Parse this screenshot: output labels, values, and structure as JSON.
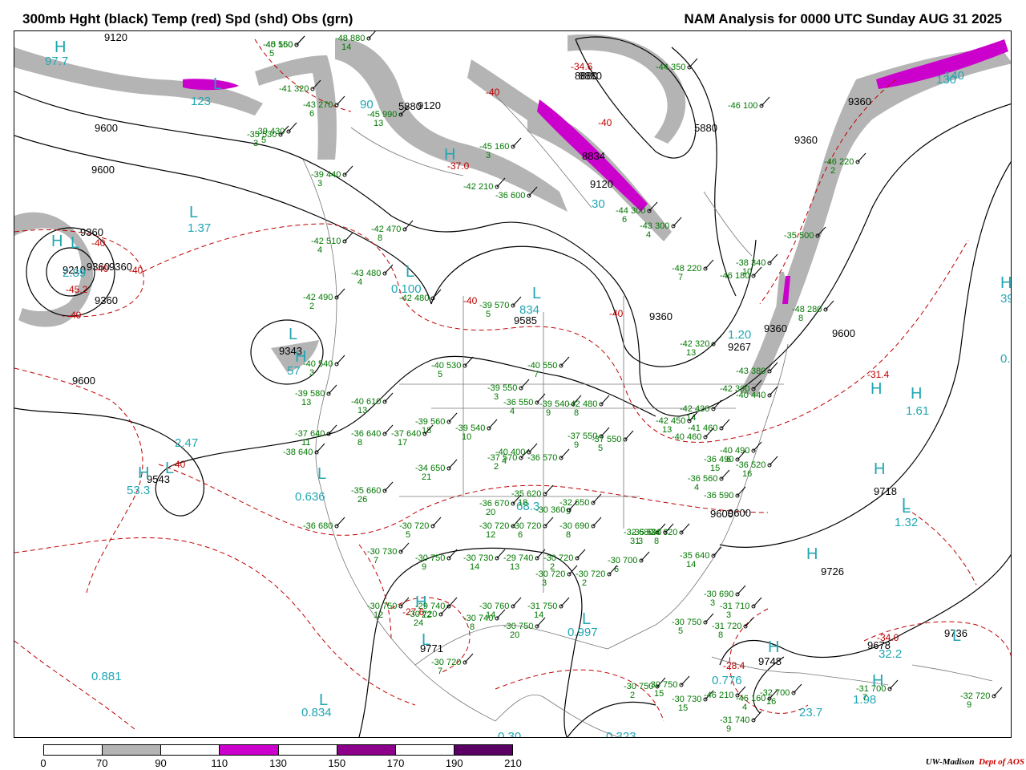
{
  "title_left": "300mb Hght (black) Temp (red) Spd (shd) Obs (grn)",
  "title_right": "NAM Analysis for 0000 UTC Sunday  AUG 31 2025",
  "credit": {
    "org": "UW-Madison",
    "dept": "Dept of AOS"
  },
  "colorbar": {
    "labels": [
      "0",
      "70",
      "90",
      "110",
      "130",
      "150",
      "170",
      "190",
      "210"
    ],
    "colors": [
      "#ffffff",
      "#b4b4b4",
      "#ffffff",
      "#cc00cc",
      "#ffffff",
      "#8c008c",
      "#ffffff",
      "#5a0064"
    ]
  },
  "height_labels": [
    "9120",
    "9600",
    "9600",
    "9360",
    "9360",
    "9360",
    "9210",
    "9360",
    "9343",
    "9600",
    "9543",
    "5880",
    "8880",
    "9120",
    "8834",
    "8880",
    "9120",
    "5880",
    "9360",
    "9360",
    "9600",
    "9585",
    "9360",
    "9267",
    "9360",
    "9600",
    "9718",
    "9726",
    "9678",
    "9736",
    "9748",
    "9771",
    "9600"
  ],
  "temp_labels": [
    "-40",
    "-40",
    "-40",
    "-45.2",
    "-40",
    "-37.0",
    "-34.6",
    "-40",
    "-40",
    "-40",
    "-40",
    "-31.4",
    "-34.0",
    "-28.4",
    "-27.6",
    "-40"
  ],
  "center_letters": [
    "H",
    "L",
    "H",
    "L",
    "L",
    "H",
    "L",
    "L",
    "L",
    "H",
    "H",
    "L",
    "L",
    "H",
    "L",
    "H",
    "H",
    "L",
    "H",
    "H",
    "L",
    "L",
    "H",
    "L",
    "H",
    "L",
    "H"
  ],
  "speed_labels": [
    "97.7",
    "123",
    "90",
    "1.37",
    "2.89",
    "0.100",
    "834",
    "1.20",
    "57",
    "2.47",
    "53.3",
    "0.636",
    "68.3",
    "0.997",
    "0.881",
    "0.834",
    "1.61",
    "1.32",
    "0.776",
    "23.7",
    "1.98",
    "32.2",
    "39.1",
    "0.8",
    "30",
    "130",
    "140",
    "0.323",
    "0.30"
  ],
  "obs": [
    {
      "t": "-45",
      "h": "160",
      "d": "5"
    },
    {
      "t": "-48",
      "h": "880",
      "d": "14"
    },
    {
      "t": "-41",
      "h": "320",
      "d": ""
    },
    {
      "t": "-43",
      "h": "270",
      "d": "6"
    },
    {
      "t": "-39",
      "h": "430",
      "d": "5"
    },
    {
      "t": "-45",
      "h": "990",
      "d": "13"
    },
    {
      "t": "-35",
      "h": "530",
      "d": "3"
    },
    {
      "t": "-45",
      "h": "160",
      "d": "3"
    },
    {
      "t": "-42",
      "h": "210",
      "d": ""
    },
    {
      "t": "-39",
      "h": "440",
      "d": "3"
    },
    {
      "t": "-42",
      "h": "470",
      "d": "8"
    },
    {
      "t": "-42",
      "h": "510",
      "d": "4"
    },
    {
      "t": "-43",
      "h": "480",
      "d": "4"
    },
    {
      "t": "-42",
      "h": "490",
      "d": "2"
    },
    {
      "t": "-42",
      "h": "480",
      "d": ""
    },
    {
      "t": "-40",
      "h": "540",
      "d": "3"
    },
    {
      "t": "-39",
      "h": "580",
      "d": "13"
    },
    {
      "t": "-40",
      "h": "610",
      "d": "13"
    },
    {
      "t": "-40",
      "h": "530",
      "d": "5"
    },
    {
      "t": "-39",
      "h": "570",
      "d": "5"
    },
    {
      "t": "-40",
      "h": "550",
      "d": "7"
    },
    {
      "t": "-39",
      "h": "550",
      "d": "3"
    },
    {
      "t": "-36",
      "h": "550",
      "d": "4"
    },
    {
      "t": "-39",
      "h": "540",
      "d": "9"
    },
    {
      "t": "-42",
      "h": "480",
      "d": "8"
    },
    {
      "t": "-39",
      "h": "560",
      "d": "18"
    },
    {
      "t": "-39",
      "h": "540",
      "d": "10"
    },
    {
      "t": "-37",
      "h": "640",
      "d": "11"
    },
    {
      "t": "-36",
      "h": "640",
      "d": "8"
    },
    {
      "t": "-37",
      "h": "640",
      "d": "17"
    },
    {
      "t": "-38",
      "h": "640",
      "d": ""
    },
    {
      "t": "-34",
      "h": "650",
      "d": "21"
    },
    {
      "t": "-37",
      "h": "570",
      "d": "2"
    },
    {
      "t": "-36",
      "h": "570",
      "d": ""
    },
    {
      "t": "-37",
      "h": "550",
      "d": "9"
    },
    {
      "t": "-37",
      "h": "550",
      "d": "5"
    },
    {
      "t": "-35",
      "h": "660",
      "d": "26"
    },
    {
      "t": "-35",
      "h": "620",
      "d": "18"
    },
    {
      "t": "-36",
      "h": "670",
      "d": "20"
    },
    {
      "t": "-32",
      "h": "650",
      "d": "9"
    },
    {
      "t": "-36",
      "h": "680",
      "d": ""
    },
    {
      "t": "-30",
      "h": "720",
      "d": "5"
    },
    {
      "t": "-30",
      "h": "720",
      "d": "12"
    },
    {
      "t": "-30",
      "h": "720",
      "d": "6"
    },
    {
      "t": "-30",
      "h": "690",
      "d": "8"
    },
    {
      "t": "-32",
      "h": "680",
      "d": "31"
    },
    {
      "t": "-34",
      "h": "620",
      "d": "8"
    },
    {
      "t": "-35",
      "h": "590",
      "d": "3"
    },
    {
      "t": "-30",
      "h": "730",
      "d": "7"
    },
    {
      "t": "-30",
      "h": "750",
      "d": "9"
    },
    {
      "t": "-30",
      "h": "730",
      "d": "14"
    },
    {
      "t": "-29",
      "h": "740",
      "d": "13"
    },
    {
      "t": "-30",
      "h": "720",
      "d": "2"
    },
    {
      "t": "-30",
      "h": "700",
      "d": "6"
    },
    {
      "t": "-30",
      "h": "720",
      "d": "2"
    },
    {
      "t": "-30",
      "h": "720",
      "d": "3"
    },
    {
      "t": "-35",
      "h": "640",
      "d": "14"
    },
    {
      "t": "-30",
      "h": "750",
      "d": "12"
    },
    {
      "t": "-29",
      "h": "740",
      "d": "22"
    },
    {
      "t": "-30",
      "h": "760",
      "d": "14"
    },
    {
      "t": "-31",
      "h": "750",
      "d": "14"
    },
    {
      "t": "-30",
      "h": "690",
      "d": "3"
    },
    {
      "t": "-31",
      "h": "710",
      "d": "3"
    },
    {
      "t": "-31",
      "h": "720",
      "d": "8"
    },
    {
      "t": "-30",
      "h": "750",
      "d": "20"
    },
    {
      "t": "-30",
      "h": "750",
      "d": "5"
    },
    {
      "t": "-30",
      "h": "720",
      "d": "24"
    },
    {
      "t": "-30",
      "h": "740",
      "d": "8"
    },
    {
      "t": "-30",
      "h": "720",
      "d": "7"
    },
    {
      "t": "-30",
      "h": "730",
      "d": "15"
    },
    {
      "t": "-30",
      "h": "750",
      "d": "2"
    },
    {
      "t": "-30",
      "h": "750",
      "d": "15"
    },
    {
      "t": "-32",
      "h": "700",
      "d": "16"
    },
    {
      "t": "-31",
      "h": "700",
      "d": "7"
    },
    {
      "t": "-32",
      "h": "720",
      "d": "9"
    },
    {
      "t": "-31",
      "h": "740",
      "d": "9"
    },
    {
      "t": "-46",
      "h": "160",
      "d": "4"
    },
    {
      "t": "-46",
      "h": "210",
      "d": ""
    },
    {
      "t": "-44",
      "h": "350",
      "d": ""
    },
    {
      "t": "-46",
      "h": "100",
      "d": ""
    },
    {
      "t": "-46",
      "h": "220",
      "d": "2"
    },
    {
      "t": "-44",
      "h": "300",
      "d": "6"
    },
    {
      "t": "-43",
      "h": "300",
      "d": "4"
    },
    {
      "t": "-48",
      "h": "220",
      "d": "7"
    },
    {
      "t": "-38",
      "h": "340",
      "d": "10"
    },
    {
      "t": "-35",
      "h": "500",
      "d": ""
    },
    {
      "t": "-46",
      "h": "180",
      "d": ""
    },
    {
      "t": "-48",
      "h": "280",
      "d": "8"
    },
    {
      "t": "-42",
      "h": "320",
      "d": "13"
    },
    {
      "t": "-43",
      "h": "380",
      "d": ""
    },
    {
      "t": "-42",
      "h": "390",
      "d": ""
    },
    {
      "t": "-40",
      "h": "440",
      "d": ""
    },
    {
      "t": "-42",
      "h": "430",
      "d": "14"
    },
    {
      "t": "-42",
      "h": "450",
      "d": "13"
    },
    {
      "t": "-41",
      "h": "460",
      "d": ""
    },
    {
      "t": "-40",
      "h": "460",
      "d": ""
    },
    {
      "t": "-40",
      "h": "490",
      "d": "6"
    },
    {
      "t": "-36",
      "h": "490",
      "d": "15"
    },
    {
      "t": "-36",
      "h": "520",
      "d": "16"
    },
    {
      "t": "-36",
      "h": "560",
      "d": "4"
    },
    {
      "t": "-36",
      "h": "590",
      "d": ""
    },
    {
      "t": "-36",
      "h": "600",
      "d": ""
    },
    {
      "t": "-40",
      "h": "400",
      "d": "4"
    },
    {
      "t": "-30",
      "h": "360",
      "d": ""
    },
    {
      "t": "-40",
      "h": "550",
      "d": ""
    }
  ]
}
